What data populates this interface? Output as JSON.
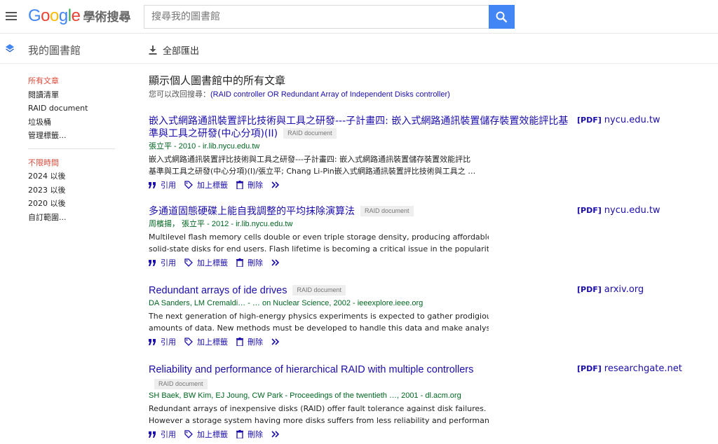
{
  "header": {
    "logo_google": "Google",
    "logo_sub": "學術搜尋",
    "search_placeholder": "搜尋我的圖書館"
  },
  "library": {
    "title": "我的圖書館",
    "export_label": "全部匯出"
  },
  "sidebar": {
    "groups": [
      [
        "所有文章",
        "閱讀清單",
        "RAID document",
        "垃圾桶",
        "管理標籤..."
      ],
      [
        "不限時間",
        "2024 以後",
        "2023 以後",
        "2020 以後",
        "自訂範圍..."
      ]
    ]
  },
  "main": {
    "heading": "顯示個人圖書館中的所有文章",
    "retry_prefix": "您可以改回搜尋：",
    "retry_query": "(RAID controller OR Redundant Array of Independent Disks controller)"
  },
  "actions": {
    "cite": "引用",
    "label": "加上標籤",
    "delete": "刪除"
  },
  "results": [
    {
      "title": "嵌入式網路通訊裝置評比技術與工具之研發---子計畫四: 嵌入式網路通訊裝置儲存裝置效能評比基準與工具之研發(中心分項)(II)",
      "badge": "RAID document",
      "meta": "張立平 - 2010 - ir.lib.nycu.edu.tw",
      "snippet": [
        "嵌入式網路通訊裝置評比技術與工具之研發---子計畫四: 嵌入式網路通訊裝置儲存裝置效能評比",
        "基準與工具之研發(中心分項)(I)/張立平; Chang Li-Pin嵌入式網路通訊裝置評比技術與工具之 …"
      ],
      "pdf_tag": "[PDF]",
      "pdf_site": "nycu.edu.tw"
    },
    {
      "title": "多通道固態硬碟上能自我調整的平均抹除演算法",
      "badge": "RAID document",
      "meta": "周檳揚， 張立平 - 2012 - ir.lib.nycu.edu.tw",
      "snippet": [
        "Multilevel flash memory cells double or even triple storage density, producing affordable",
        "solid-state disks for end users. Flash lifetime is becoming a critical issue in the popularity of …"
      ],
      "pdf_tag": "[PDF]",
      "pdf_site": "nycu.edu.tw"
    },
    {
      "title": "Redundant arrays of ide drives",
      "badge": "RAID document",
      "meta": "DA Sanders, LM Cremaldi… - … on Nuclear Science, 2002 - ieeexplore.ieee.org",
      "snippet": [
        "The next generation of high-energy physics experiments is expected to gather prodigious",
        "amounts of data. New methods must be developed to handle this data and make analysis at …"
      ],
      "pdf_tag": "[PDF]",
      "pdf_site": "arxiv.org"
    },
    {
      "title": "Reliability and performance of hierarchical RAID with multiple controllers",
      "badge": "RAID document",
      "meta": "SH Baek, BW Kim, EJ Joung, CW Park - Proceedings of the twentieth …, 2001 - dl.acm.org",
      "snippet": [
        "Redundant arrays of inexpensive disks (RAID) offer fault tolerance against disk failures.",
        "However a storage system having more disks suffers from less reliability and performance. A …"
      ],
      "pdf_tag": "[PDF]",
      "pdf_site": "researchgate.net"
    }
  ],
  "colors": {
    "link": "#1a0dab",
    "meta_green": "#006621",
    "active_red": "#dd4b39",
    "search_blue": "#4285f4"
  }
}
